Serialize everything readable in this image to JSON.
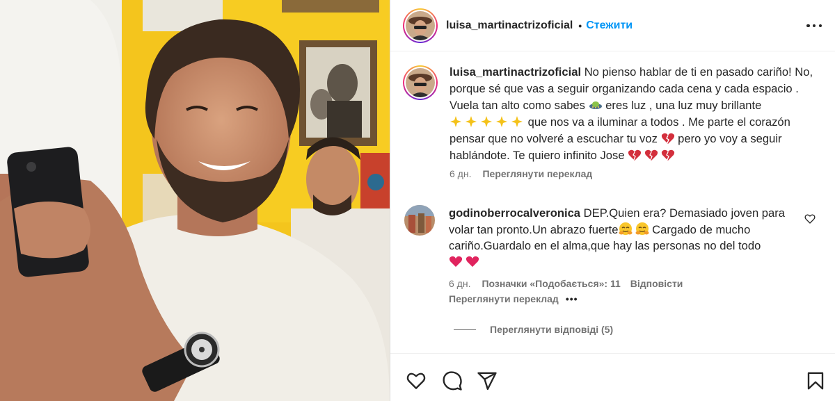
{
  "post": {
    "author": "luisa_martinactrizoficial",
    "separator": "•",
    "follow_label": "Стежити",
    "more_label": "Ще"
  },
  "caption": {
    "author": "luisa_martinactrizoficial",
    "text_1": "No pienso hablar de ti en pasado cariño! No, porque sé que vas a seguir organizando cada cena y cada espacio . Vuela tan alto como sabes",
    "text_2": "eres luz , una luz muy brillante",
    "text_3": "que nos va a iluminar a todos . Me parte el corazón pensar que no volveré a escuchar tu voz",
    "text_4": "pero yo voy a seguir hablándote. Te quiero infinito Jose",
    "age": "6 дн.",
    "translate_label": "Переглянути переклад"
  },
  "comment": {
    "author": "godinoberrocalveronica",
    "text_1": "DEP.Quien era? Demasiado joven para volar tan pronto.Un abrazo fuerte",
    "text_2": "Cargado de mucho cariño.Guardalo en el alma,que hay las personas no del todo",
    "age": "6 дн.",
    "likes_label": "Позначки «Подобається»: 11",
    "reply_label": "Відповісти",
    "translate_label": "Переглянути переклад",
    "more_label": "•••"
  },
  "replies": {
    "label": "Переглянути відповіді (5)"
  },
  "icons": {
    "like": "heart-icon",
    "comment": "comment-icon",
    "share": "paper-plane-icon",
    "save": "bookmark-icon"
  },
  "colors": {
    "link_blue": "#0095f6",
    "text": "#262626",
    "secondary": "#737373",
    "heart_red": "#e0245e"
  }
}
